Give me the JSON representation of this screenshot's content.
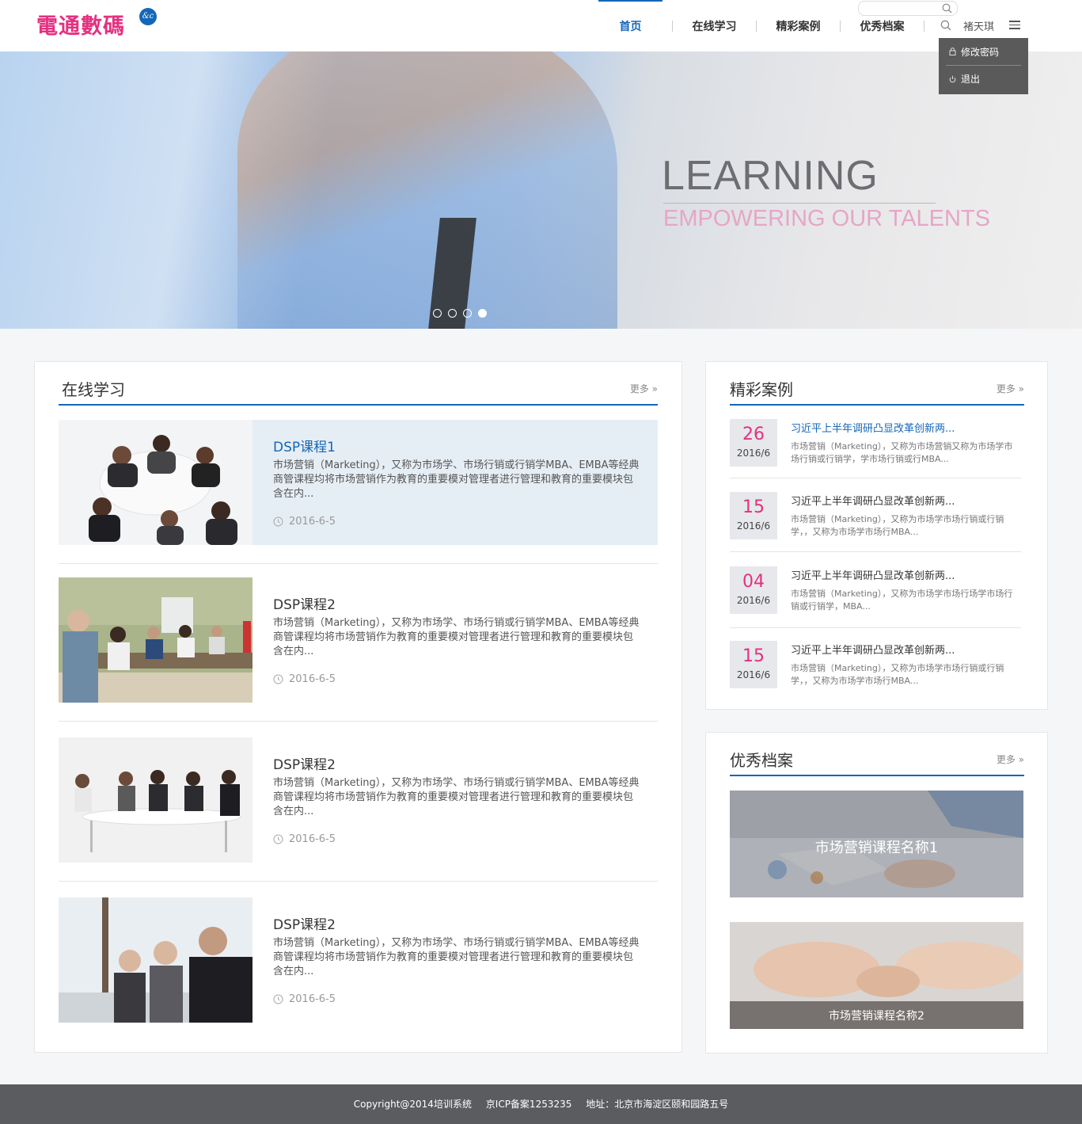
{
  "header": {
    "logo_text": "電通數碼",
    "logo_badge": "&c",
    "nav": [
      "首页",
      "在线学习",
      "精彩案例",
      "优秀档案"
    ],
    "active_nav": "首页",
    "search_placeholder": "",
    "username": "褚天琪",
    "dropdown": [
      "修改密码",
      "退出"
    ]
  },
  "banner": {
    "title": "LEARNING",
    "subtitle": "EMPOWERING OUR TALENTS",
    "slide_count": 4,
    "active_slide": 4
  },
  "online": {
    "title": "在线学习",
    "more": "更多 »",
    "courses": [
      {
        "title": "DSP课程1",
        "desc": "市场营销（Marketing），又称为市场学、市场行销或行销学MBA、EMBA等经典商管课程均将市场营销作为教育的重要模对管理者进行管理和教育的重要模块包含在内...",
        "date": "2016-6-5"
      },
      {
        "title": "DSP课程2",
        "desc": "市场营销（Marketing），又称为市场学、市场行销或行销学MBA、EMBA等经典商管课程均将市场营销作为教育的重要模对管理者进行管理和教育的重要模块包含在内...",
        "date": "2016-6-5"
      },
      {
        "title": "DSP课程2",
        "desc": "市场营销（Marketing），又称为市场学、市场行销或行销学MBA、EMBA等经典商管课程均将市场营销作为教育的重要模对管理者进行管理和教育的重要模块包含在内...",
        "date": "2016-6-5"
      },
      {
        "title": "DSP课程2",
        "desc": "市场营销（Marketing），又称为市场学、市场行销或行销学MBA、EMBA等经典商管课程均将市场营销作为教育的重要模对管理者进行管理和教育的重要模块包含在内...",
        "date": "2016-6-5"
      }
    ]
  },
  "cases": {
    "title": "精彩案例",
    "more": "更多 »",
    "items": [
      {
        "day": "26",
        "month": "2016/6",
        "title": "习近平上半年调研凸显改革创新两...",
        "desc": "市场营销（Marketing），又称为市场营销又称为市场学市场行销或行销学，学市场行销或行MBA..."
      },
      {
        "day": "15",
        "month": "2016/6",
        "title": "习近平上半年调研凸显改革创新两...",
        "desc": "市场营销（Marketing），又称为市场学市场行销或行销学，，又称为市场学市场行MBA..."
      },
      {
        "day": "04",
        "month": "2016/6",
        "title": "习近平上半年调研凸显改革创新两...",
        "desc": "市场营销（Marketing），又称为市场学市场行场学市场行销或行销学，MBA..."
      },
      {
        "day": "15",
        "month": "2016/6",
        "title": "习近平上半年调研凸显改革创新两...",
        "desc": "市场营销（Marketing），又称为市场学市场行销或行销学，，又称为市场学市场行MBA..."
      }
    ]
  },
  "archives": {
    "title": "优秀档案",
    "more": "更多 »",
    "items": [
      "市场营销课程名称1",
      "市场营销课程名称2"
    ]
  },
  "footer": {
    "copyright": "Copyright@2014培训系统",
    "icp": "京ICP备案1253235",
    "address": "地址：北京市海淀区颐和园路五号"
  },
  "colors": {
    "accent": "#1466b8",
    "brand": "#e5307f",
    "footer": "#5b5c60"
  }
}
